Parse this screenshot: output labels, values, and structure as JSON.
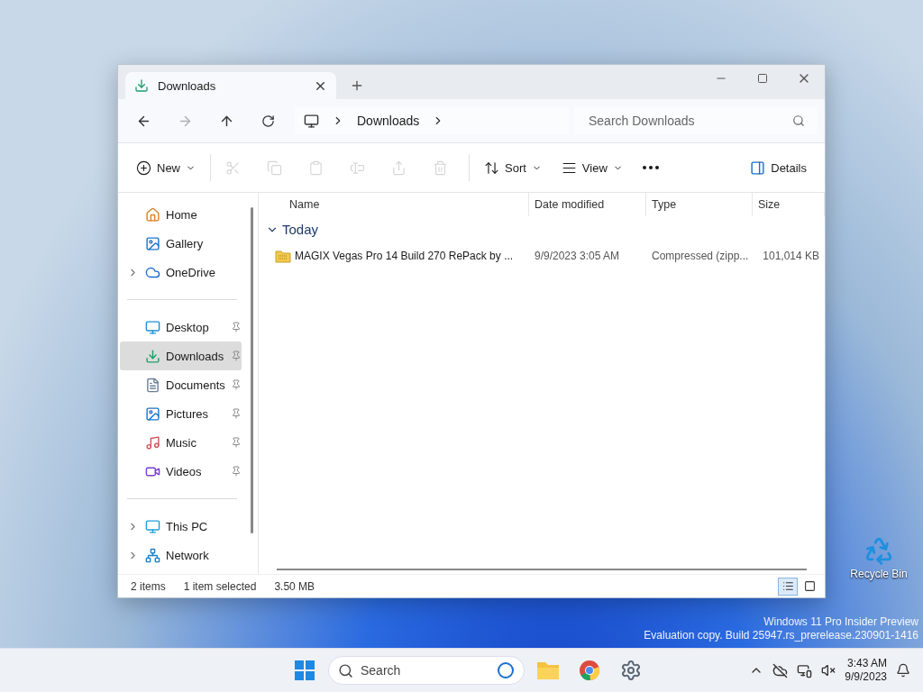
{
  "desktop": {
    "icons": [
      {
        "label": "Recycle Bin"
      }
    ],
    "watermark": [
      "Windows 11 Pro Insider Preview",
      "Evaluation copy. Build 25947.rs_prerelease.230901-1416"
    ]
  },
  "window": {
    "tabs": [
      {
        "title": "Downloads",
        "selected": true
      }
    ],
    "address": {
      "crumbs": [
        "Downloads"
      ],
      "search_placeholder": "Search Downloads"
    },
    "commands": [
      {
        "kind": "new",
        "label": "New",
        "disabled": false
      },
      {
        "kind": "cut",
        "disabled": true
      },
      {
        "kind": "copy",
        "disabled": true
      },
      {
        "kind": "paste",
        "disabled": true
      },
      {
        "kind": "rename",
        "disabled": true
      },
      {
        "kind": "share",
        "disabled": true
      },
      {
        "kind": "delete",
        "disabled": true
      },
      {
        "kind": "sort",
        "label": "Sort",
        "disabled": false
      },
      {
        "kind": "view",
        "label": "View",
        "disabled": false
      },
      {
        "kind": "more",
        "disabled": false
      }
    ],
    "details_button": "Details",
    "sidebar": [
      [
        {
          "kind": "home",
          "label": "Home",
          "expandable": false,
          "pinned": false,
          "selected": false
        },
        {
          "kind": "gallery",
          "label": "Gallery",
          "expandable": false,
          "pinned": false,
          "selected": false
        },
        {
          "kind": "cloud",
          "label": "OneDrive",
          "expandable": true,
          "pinned": false,
          "selected": false
        }
      ],
      [
        {
          "kind": "desktop",
          "label": "Desktop",
          "expandable": false,
          "pinned": true,
          "selected": false
        },
        {
          "kind": "download",
          "label": "Downloads",
          "expandable": false,
          "pinned": true,
          "selected": true
        },
        {
          "kind": "documents",
          "label": "Documents",
          "expandable": false,
          "pinned": true,
          "selected": false
        },
        {
          "kind": "pictures",
          "label": "Pictures",
          "expandable": false,
          "pinned": true,
          "selected": false
        },
        {
          "kind": "music",
          "label": "Music",
          "expandable": false,
          "pinned": true,
          "selected": false
        },
        {
          "kind": "videos",
          "label": "Videos",
          "expandable": false,
          "pinned": true,
          "selected": false
        }
      ],
      [
        {
          "kind": "pc",
          "label": "This PC",
          "expandable": true,
          "pinned": false,
          "selected": false
        },
        {
          "kind": "network",
          "label": "Network",
          "expandable": true,
          "pinned": false,
          "selected": false
        }
      ]
    ],
    "columns": [
      "Name",
      "Date modified",
      "Type",
      "Size"
    ],
    "groups": [
      {
        "label": "Today",
        "expanded": true,
        "rows": [
          {
            "name": "MAGIX Vegas Pro 14 Build 270 RePack by ...",
            "date": "9/9/2023 3:05 AM",
            "type": "Compressed (zipp...",
            "size": "101,014 KB",
            "selected": false
          }
        ]
      }
    ],
    "status": {
      "count": "2 items",
      "selection": "1 item selected",
      "size": "3.50 MB",
      "views": [
        {
          "kind": "details",
          "selected": true
        },
        {
          "kind": "tiles",
          "selected": false
        }
      ]
    }
  },
  "taskbar": {
    "search_placeholder": "Search",
    "clock": {
      "time": "3:43 AM",
      "date": "9/9/2023"
    }
  }
}
